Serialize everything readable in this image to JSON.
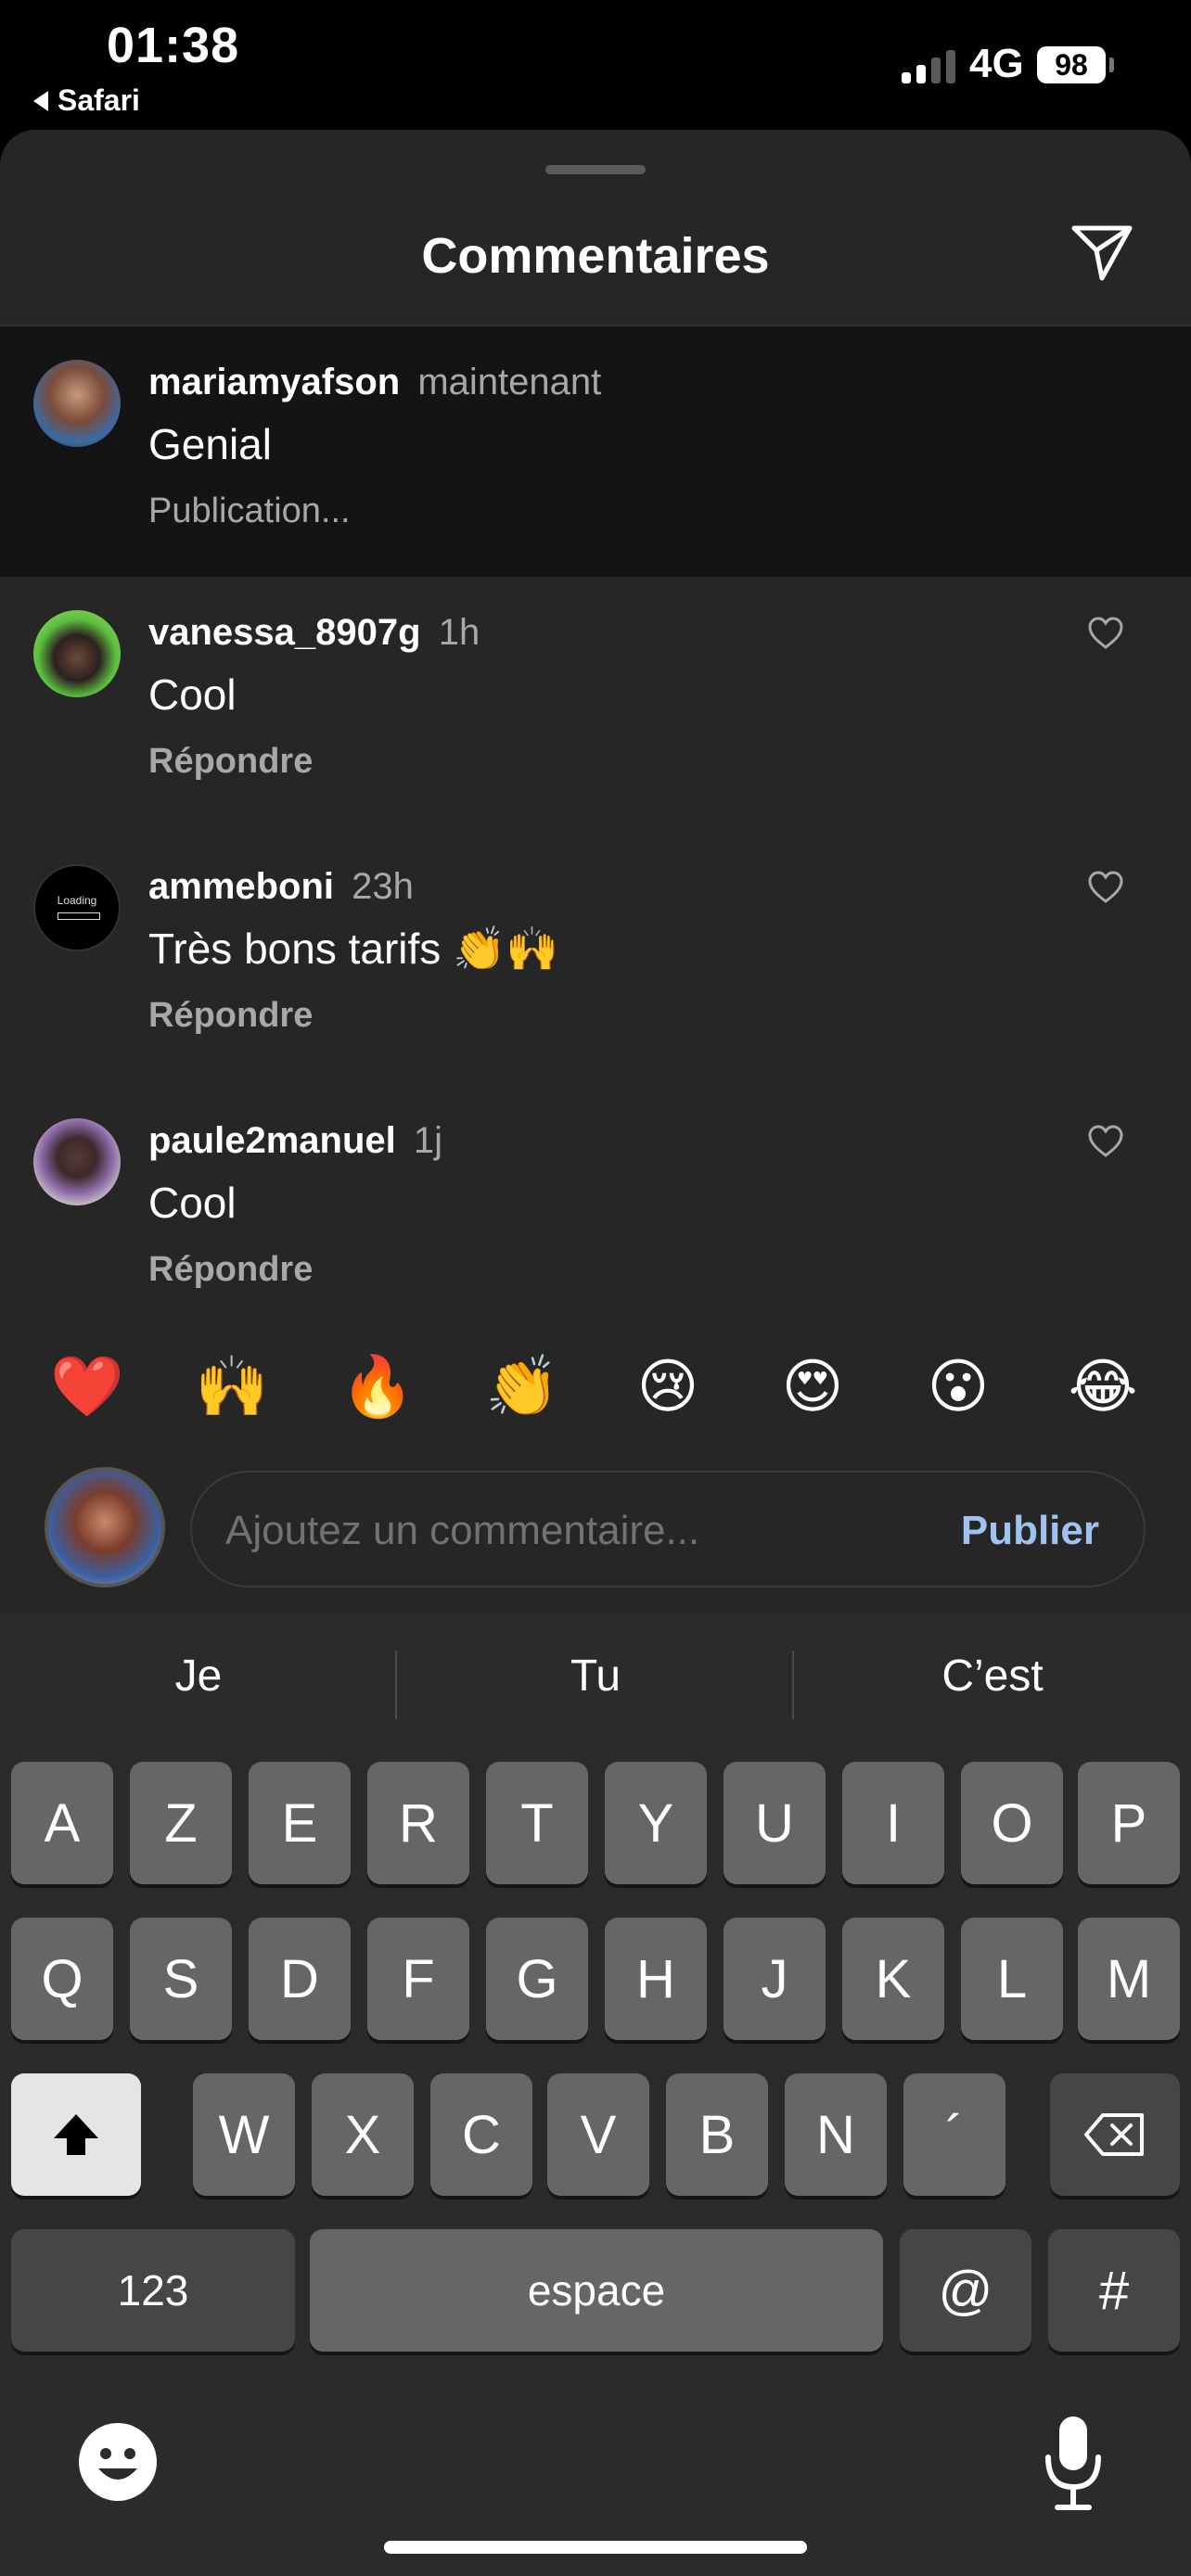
{
  "status_bar": {
    "time": "01:38",
    "back_app": "Safari",
    "network": "4G",
    "battery": "98"
  },
  "sheet": {
    "title": "Commentaires"
  },
  "comments": [
    {
      "user": "mariamyafson",
      "time": "maintenant",
      "text": "Genial",
      "action": "Publication...",
      "pending": true
    },
    {
      "user": "vanessa_8907g",
      "time": "1h",
      "text": "Cool",
      "action": "Répondre"
    },
    {
      "user": "ammeboni",
      "time": "23h",
      "text": "Très bons tarifs 👏🙌",
      "action": "Répondre",
      "avatar_text": "Loading"
    },
    {
      "user": "paule2manuel",
      "time": "1j",
      "text": "Cool",
      "action": "Répondre"
    }
  ],
  "quick_emojis": [
    "❤️",
    "🙌",
    "🔥",
    "👏",
    "😢",
    "😍",
    "😮",
    "😂"
  ],
  "comment_input": {
    "placeholder": "Ajoutez un commentaire...",
    "publish_label": "Publier"
  },
  "keyboard": {
    "suggestions": [
      "Je",
      "Tu",
      "C’est"
    ],
    "row1": [
      "A",
      "Z",
      "E",
      "R",
      "T",
      "Y",
      "U",
      "I",
      "O",
      "P"
    ],
    "row2": [
      "Q",
      "S",
      "D",
      "F",
      "G",
      "H",
      "J",
      "K",
      "L",
      "M"
    ],
    "row3": [
      "W",
      "X",
      "C",
      "V",
      "B",
      "N",
      "´"
    ],
    "numbers_label": "123",
    "space_label": "espace",
    "at_label": "@",
    "hash_label": "#"
  },
  "colors": {
    "sheet_bg": "#262626",
    "pending_bg": "#141414",
    "publish": "#9fc2f0",
    "muted_text": "#a8a8a8",
    "key": "#666666",
    "key_fn": "#464646"
  }
}
